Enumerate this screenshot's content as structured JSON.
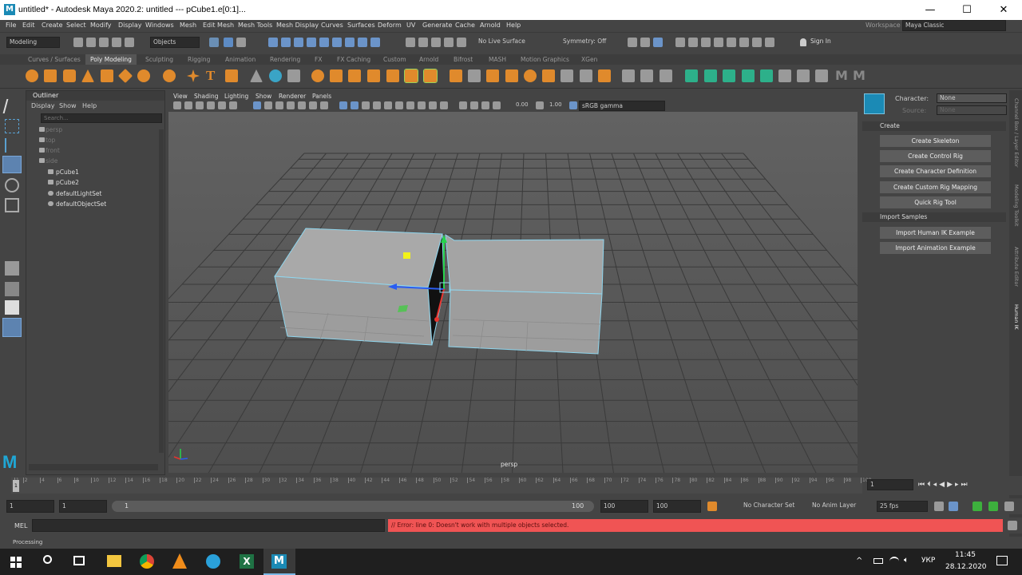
{
  "window": {
    "title": "untitled* - Autodesk Maya 2020.2: untitled   ---   pCube1.e[0:1]...",
    "logo": "M",
    "min": "—",
    "max": "☐",
    "close": "✕"
  },
  "menubar": [
    "File",
    "Edit",
    "Create",
    "Select",
    "Modify",
    "Display",
    "Windows",
    "Mesh",
    "Edit Mesh",
    "Mesh Tools",
    "Mesh Display",
    "Curves",
    "Surfaces",
    "Deform",
    "UV",
    "Generate",
    "Cache",
    "Arnold",
    "Help"
  ],
  "workspace": {
    "label": "Workspace :",
    "value": "Maya Classic"
  },
  "statusline": {
    "menuset": "Modeling",
    "selmode": "Objects",
    "live": "No Live Surface",
    "symmetry": "Symmetry: Off",
    "signin": "Sign In"
  },
  "shelf_tabs": [
    "Curves / Surfaces",
    "Poly Modeling",
    "Sculpting",
    "Rigging",
    "Animation",
    "Rendering",
    "FX",
    "FX Caching",
    "Custom",
    "Arnold",
    "Bifrost",
    "MASH",
    "Motion Graphics",
    "XGen"
  ],
  "shelf_active": "Poly Modeling",
  "outliner": {
    "title": "Outliner",
    "menus": [
      "Display",
      "Show",
      "Help"
    ],
    "search_placeholder": "Search...",
    "items": [
      {
        "label": "persp",
        "dim": true
      },
      {
        "label": "top",
        "dim": true
      },
      {
        "label": "front",
        "dim": true
      },
      {
        "label": "side",
        "dim": true
      },
      {
        "label": "pCube1",
        "dim": false
      },
      {
        "label": "pCube2",
        "dim": false
      },
      {
        "label": "defaultLightSet",
        "dim": false
      },
      {
        "label": "defaultObjectSet",
        "dim": false
      }
    ]
  },
  "viewport": {
    "menus": [
      "View",
      "Shading",
      "Lighting",
      "Show",
      "Renderer",
      "Panels"
    ],
    "exposure": "0.00",
    "gamma": "1.00",
    "colorspace": "sRGB gamma",
    "camera_label": "persp"
  },
  "humanik": {
    "character_label": "Character:",
    "character_value": "None",
    "source_label": "Source:",
    "source_value": "None",
    "create_section": "Create",
    "create_buttons": [
      "Create Skeleton",
      "Create Control Rig",
      "Create Character Definition",
      "Create Custom Rig Mapping",
      "Quick Rig Tool"
    ],
    "import_section": "Import Samples",
    "import_buttons": [
      "Import Human IK Example",
      "Import Animation Example"
    ]
  },
  "side_tabs": [
    "Channel Box / Layer Editor",
    "Modeling Toolkit",
    "Attribute Editor",
    "Human IK"
  ],
  "timeline": {
    "ticks": [
      "1",
      "2",
      "4",
      "6",
      "8",
      "10",
      "12",
      "14",
      "16",
      "18",
      "20",
      "22",
      "24",
      "26",
      "28",
      "30",
      "32",
      "34",
      "36",
      "38",
      "40",
      "42",
      "44",
      "46",
      "48",
      "50",
      "52",
      "54",
      "56",
      "58",
      "60",
      "62",
      "64",
      "66",
      "68",
      "70",
      "72",
      "74",
      "76",
      "78",
      "80",
      "82",
      "84",
      "86",
      "88",
      "90",
      "92",
      "94",
      "96",
      "98",
      "100"
    ],
    "current_frame": "1"
  },
  "range": {
    "start": "1",
    "start2": "1",
    "slider_start": "1",
    "slider_end": "100",
    "end": "100",
    "end2": "100",
    "character_set": "No Character Set",
    "anim_layer": "No Anim Layer",
    "fps": "25 fps"
  },
  "cmdline": {
    "lang": "MEL",
    "error": "// Error: line 0: Doesn't work with multiple objects selected."
  },
  "helpline": {
    "text": "Processing"
  },
  "taskbar": {
    "time": "11:45",
    "date": "28.12.2020",
    "lang": "УКР"
  },
  "colors": {
    "error_bg": "#f05454",
    "accent": "#1b8ab5",
    "shelf_icon": "#e08a2c"
  }
}
